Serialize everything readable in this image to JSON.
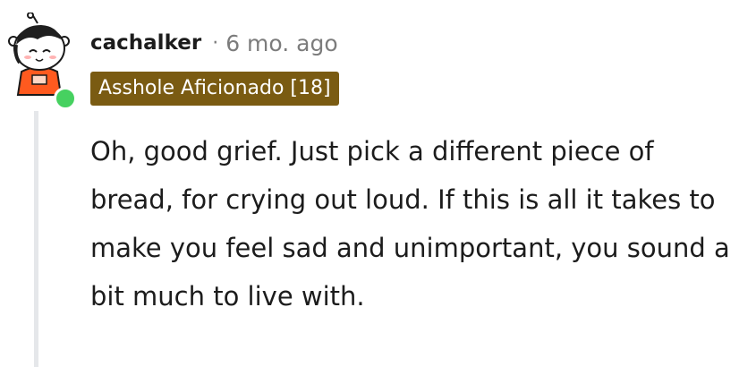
{
  "comment": {
    "author": "cachalker",
    "separator": "·",
    "timestamp": "6 mo. ago",
    "flair": "Asshole Aficionado [18]",
    "body": "Oh, good grief. Just pick a different piece of bread, for crying out loud. If this is all it takes to make you feel sad and unimportant, you sound a bit much to live with."
  },
  "avatar": {
    "icon": "snoo-avatar-icon",
    "status": "online"
  },
  "colors": {
    "flair_background": "#7a5b12",
    "online_indicator": "#46d160",
    "thread_line": "#e5e7ea",
    "muted_text": "#7c7c7c",
    "body_text": "#1c1c1c"
  }
}
